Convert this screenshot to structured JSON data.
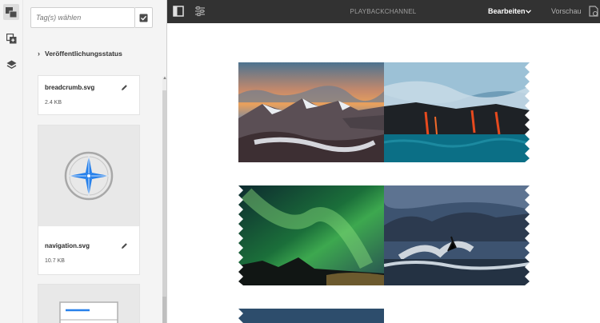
{
  "rail": {
    "icons": [
      "assets-icon",
      "components-icon",
      "layers-icon"
    ],
    "active": "assets-icon"
  },
  "panel": {
    "tag_placeholder": "Tag(s) wählen",
    "filter_label": "Veröffentlichungsstatus",
    "assets": [
      {
        "name": "breadcrumb.svg",
        "size": "2.4 KB"
      },
      {
        "name": "navigation.svg",
        "size": "10.7 KB"
      }
    ]
  },
  "toolbar": {
    "title": "PLAYBACKCHANNEL",
    "mode": "Bearbeiten",
    "preview": "Vorschau"
  },
  "canvas": {
    "images": [
      "snowy-mountains-sunset",
      "lava-flowing-into-ocean",
      "green-aurora-night-sky",
      "surfer-on-wave",
      "dark-blue-image-partial"
    ]
  },
  "colors": {
    "toolbar_bg": "#323232",
    "panel_bg": "#f4f4f4",
    "accent_blue": "#2680eb"
  }
}
